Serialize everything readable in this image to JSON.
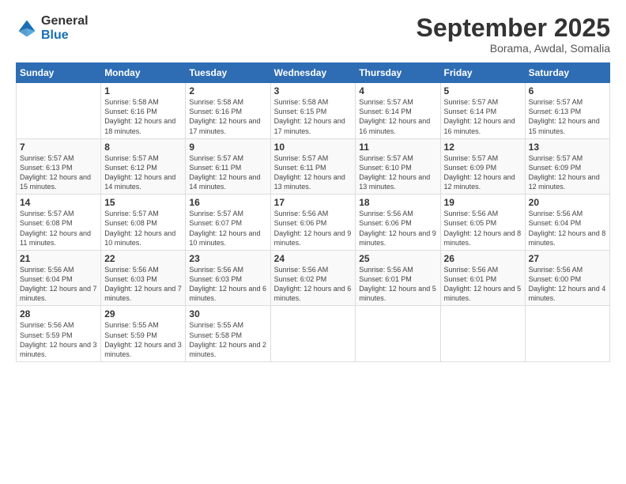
{
  "logo": {
    "general": "General",
    "blue": "Blue"
  },
  "title": "September 2025",
  "subtitle": "Borama, Awdal, Somalia",
  "days_of_week": [
    "Sunday",
    "Monday",
    "Tuesday",
    "Wednesday",
    "Thursday",
    "Friday",
    "Saturday"
  ],
  "weeks": [
    [
      {
        "day": "",
        "info": ""
      },
      {
        "day": "1",
        "info": "Sunrise: 5:58 AM\nSunset: 6:16 PM\nDaylight: 12 hours\nand 18 minutes."
      },
      {
        "day": "2",
        "info": "Sunrise: 5:58 AM\nSunset: 6:16 PM\nDaylight: 12 hours\nand 17 minutes."
      },
      {
        "day": "3",
        "info": "Sunrise: 5:58 AM\nSunset: 6:15 PM\nDaylight: 12 hours\nand 17 minutes."
      },
      {
        "day": "4",
        "info": "Sunrise: 5:57 AM\nSunset: 6:14 PM\nDaylight: 12 hours\nand 16 minutes."
      },
      {
        "day": "5",
        "info": "Sunrise: 5:57 AM\nSunset: 6:14 PM\nDaylight: 12 hours\nand 16 minutes."
      },
      {
        "day": "6",
        "info": "Sunrise: 5:57 AM\nSunset: 6:13 PM\nDaylight: 12 hours\nand 15 minutes."
      }
    ],
    [
      {
        "day": "7",
        "info": "Sunrise: 5:57 AM\nSunset: 6:13 PM\nDaylight: 12 hours\nand 15 minutes."
      },
      {
        "day": "8",
        "info": "Sunrise: 5:57 AM\nSunset: 6:12 PM\nDaylight: 12 hours\nand 14 minutes."
      },
      {
        "day": "9",
        "info": "Sunrise: 5:57 AM\nSunset: 6:11 PM\nDaylight: 12 hours\nand 14 minutes."
      },
      {
        "day": "10",
        "info": "Sunrise: 5:57 AM\nSunset: 6:11 PM\nDaylight: 12 hours\nand 13 minutes."
      },
      {
        "day": "11",
        "info": "Sunrise: 5:57 AM\nSunset: 6:10 PM\nDaylight: 12 hours\nand 13 minutes."
      },
      {
        "day": "12",
        "info": "Sunrise: 5:57 AM\nSunset: 6:09 PM\nDaylight: 12 hours\nand 12 minutes."
      },
      {
        "day": "13",
        "info": "Sunrise: 5:57 AM\nSunset: 6:09 PM\nDaylight: 12 hours\nand 12 minutes."
      }
    ],
    [
      {
        "day": "14",
        "info": "Sunrise: 5:57 AM\nSunset: 6:08 PM\nDaylight: 12 hours\nand 11 minutes."
      },
      {
        "day": "15",
        "info": "Sunrise: 5:57 AM\nSunset: 6:08 PM\nDaylight: 12 hours\nand 10 minutes."
      },
      {
        "day": "16",
        "info": "Sunrise: 5:57 AM\nSunset: 6:07 PM\nDaylight: 12 hours\nand 10 minutes."
      },
      {
        "day": "17",
        "info": "Sunrise: 5:56 AM\nSunset: 6:06 PM\nDaylight: 12 hours\nand 9 minutes."
      },
      {
        "day": "18",
        "info": "Sunrise: 5:56 AM\nSunset: 6:06 PM\nDaylight: 12 hours\nand 9 minutes."
      },
      {
        "day": "19",
        "info": "Sunrise: 5:56 AM\nSunset: 6:05 PM\nDaylight: 12 hours\nand 8 minutes."
      },
      {
        "day": "20",
        "info": "Sunrise: 5:56 AM\nSunset: 6:04 PM\nDaylight: 12 hours\nand 8 minutes."
      }
    ],
    [
      {
        "day": "21",
        "info": "Sunrise: 5:56 AM\nSunset: 6:04 PM\nDaylight: 12 hours\nand 7 minutes."
      },
      {
        "day": "22",
        "info": "Sunrise: 5:56 AM\nSunset: 6:03 PM\nDaylight: 12 hours\nand 7 minutes."
      },
      {
        "day": "23",
        "info": "Sunrise: 5:56 AM\nSunset: 6:03 PM\nDaylight: 12 hours\nand 6 minutes."
      },
      {
        "day": "24",
        "info": "Sunrise: 5:56 AM\nSunset: 6:02 PM\nDaylight: 12 hours\nand 6 minutes."
      },
      {
        "day": "25",
        "info": "Sunrise: 5:56 AM\nSunset: 6:01 PM\nDaylight: 12 hours\nand 5 minutes."
      },
      {
        "day": "26",
        "info": "Sunrise: 5:56 AM\nSunset: 6:01 PM\nDaylight: 12 hours\nand 5 minutes."
      },
      {
        "day": "27",
        "info": "Sunrise: 5:56 AM\nSunset: 6:00 PM\nDaylight: 12 hours\nand 4 minutes."
      }
    ],
    [
      {
        "day": "28",
        "info": "Sunrise: 5:56 AM\nSunset: 5:59 PM\nDaylight: 12 hours\nand 3 minutes."
      },
      {
        "day": "29",
        "info": "Sunrise: 5:55 AM\nSunset: 5:59 PM\nDaylight: 12 hours\nand 3 minutes."
      },
      {
        "day": "30",
        "info": "Sunrise: 5:55 AM\nSunset: 5:58 PM\nDaylight: 12 hours\nand 2 minutes."
      },
      {
        "day": "",
        "info": ""
      },
      {
        "day": "",
        "info": ""
      },
      {
        "day": "",
        "info": ""
      },
      {
        "day": "",
        "info": ""
      }
    ]
  ]
}
